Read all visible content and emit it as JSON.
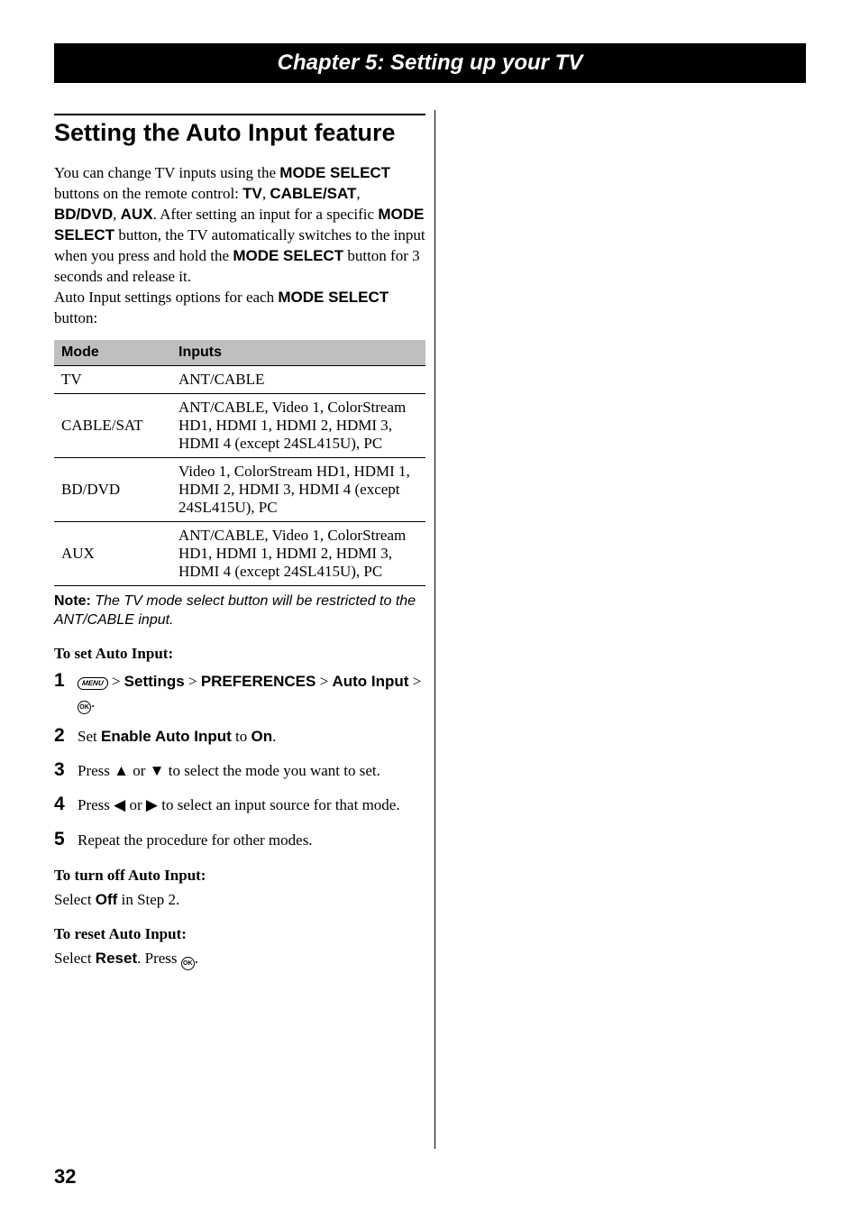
{
  "header": {
    "chapter": "Chapter 5: Setting up your TV"
  },
  "section": {
    "title": "Setting the Auto Input feature"
  },
  "intro": {
    "t1": "You can change TV inputs using the ",
    "b1": "MODE SELECT",
    "t2": " buttons on the remote control: ",
    "b2": "TV",
    "t3": ", ",
    "b3": "CABLE/SAT",
    "t4": ", ",
    "b4": "BD/DVD",
    "t5": ", ",
    "b5": "AUX",
    "t6": ". After setting an input for a specific ",
    "b6": "MODE SELECT",
    "t7": " button, the TV automatically switches to the input when you press and hold the ",
    "b7": "MODE SELECT",
    "t8": " button for 3 seconds and release it.",
    "t9": "Auto Input settings options for each ",
    "b8": "MODE SELECT",
    "t10": " button:"
  },
  "table": {
    "h1": "Mode",
    "h2": "Inputs",
    "rows": [
      {
        "mode": "TV",
        "inputs": "ANT/CABLE"
      },
      {
        "mode": "CABLE/SAT",
        "inputs": "ANT/CABLE, Video 1, ColorStream HD1, HDMI 1, HDMI 2, HDMI 3, HDMI 4 (except 24SL415U), PC"
      },
      {
        "mode": "BD/DVD",
        "inputs": "Video 1, ColorStream HD1, HDMI 1, HDMI 2, HDMI 3, HDMI 4 (except 24SL415U), PC"
      },
      {
        "mode": "AUX",
        "inputs": "ANT/CABLE, Video 1, ColorStream HD1, HDMI 1, HDMI 2, HDMI 3, HDMI 4 (except 24SL415U), PC"
      }
    ]
  },
  "note": {
    "label": "Note:",
    "text": " The TV mode select button will be restricted to the ANT/CABLE input."
  },
  "set": {
    "heading": "To set Auto Input:",
    "step1": {
      "menu": "MENU",
      "gt1": " > ",
      "b1": "Settings",
      "gt2": " > ",
      "b2": "PREFERENCES",
      "gt3": " > ",
      "b3": "Auto Input",
      "gt4": " > ",
      "ok": "OK",
      "dot": "."
    },
    "step2": {
      "t1": "Set ",
      "b1": "Enable Auto Input",
      "t2": " to ",
      "b2": "On",
      "t3": "."
    },
    "step3": {
      "t1": "Press ",
      "up": "▲",
      "t2": " or ",
      "down": "▼",
      "t3": " to select the mode you want to set."
    },
    "step4": {
      "t1": "Press ",
      "left": "◀",
      "t2": " or ",
      "right": "▶",
      "t3": " to select an input source for that mode."
    },
    "step5": {
      "t1": "Repeat the procedure for other modes."
    }
  },
  "off": {
    "heading": "To turn off Auto Input:",
    "t1": "Select ",
    "b1": "Off",
    "t2": " in Step 2."
  },
  "reset": {
    "heading": "To reset Auto Input:",
    "t1": "Select ",
    "b1": "Reset",
    "t2": ". Press ",
    "ok": "OK",
    "t3": "."
  },
  "page_num": "32"
}
